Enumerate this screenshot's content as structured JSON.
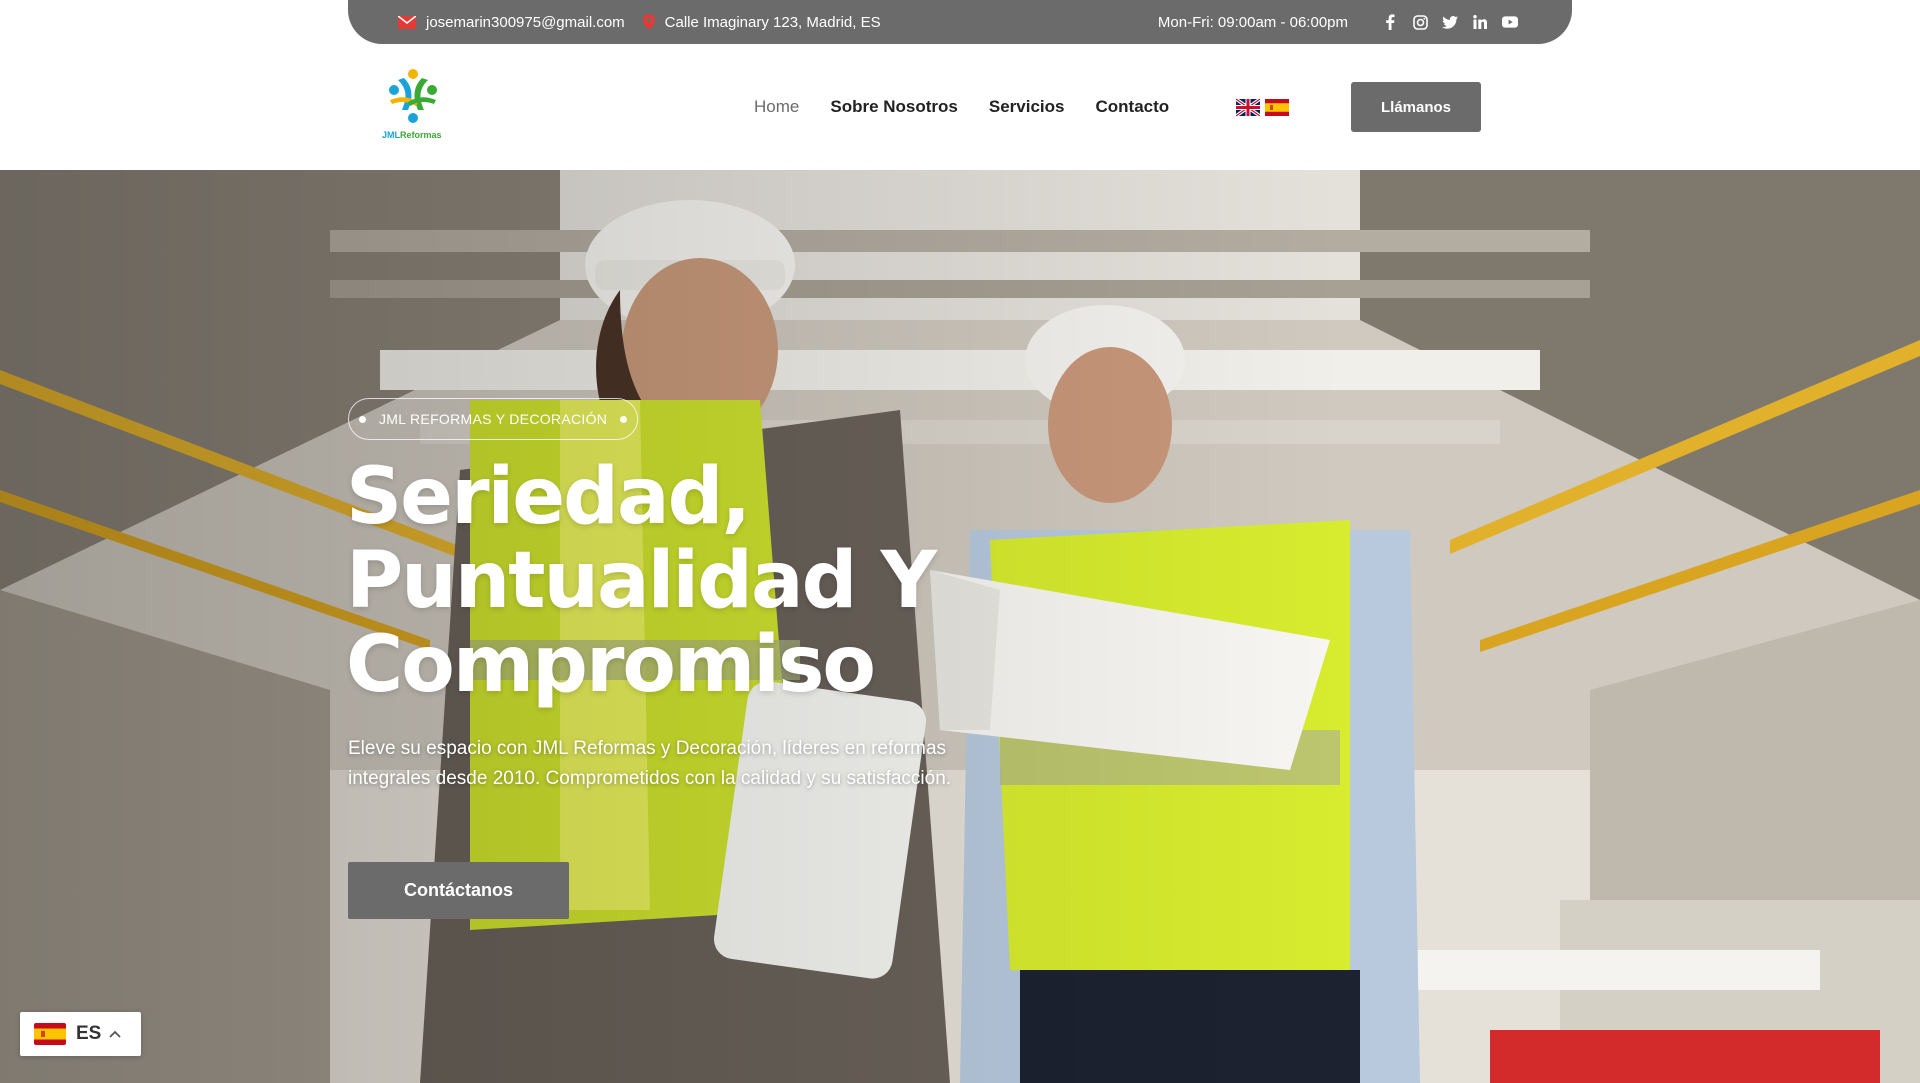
{
  "topbar": {
    "email": "josemarin300975@gmail.com",
    "address": "Calle Imaginary 123, Madrid, ES",
    "hours": "Mon-Fri: 09:00am - 06:00pm",
    "socials": [
      "facebook-icon",
      "instagram-icon",
      "twitter-icon",
      "linkedin-icon",
      "youtube-icon"
    ]
  },
  "header": {
    "logo_text_a": "JML",
    "logo_text_b": "Reformas",
    "nav": [
      {
        "label": "Home",
        "active": true
      },
      {
        "label": "Sobre Nosotros",
        "active": false
      },
      {
        "label": "Servicios",
        "active": false
      },
      {
        "label": "Contacto",
        "active": false
      }
    ],
    "flags": [
      "uk-flag-icon",
      "spain-flag-icon"
    ],
    "call_button": "Llámanos"
  },
  "hero": {
    "badge": "JML REFORMAS Y DECORACIÓN",
    "title_line1": "Seriedad,",
    "title_line2": "Puntualidad Y",
    "title_line3": "Compromiso",
    "text": "Eleve su espacio con JML Reformas y Decoración, líderes en reformas integrales desde 2010. Comprometidos con la calidad y su satisfacción.",
    "cta": "Contáctanos"
  },
  "language_switcher": {
    "code": "ES",
    "flag": "spain-flag-icon"
  },
  "colors": {
    "primary_gray": "#6b6b6b",
    "logo_green": "#3aa935",
    "logo_blue": "#1aa3d8",
    "logo_yellow": "#f2b400"
  }
}
